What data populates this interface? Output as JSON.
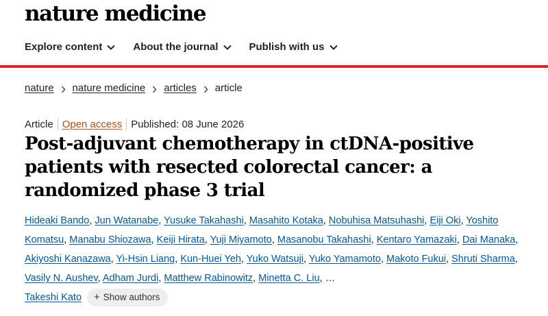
{
  "header": {
    "logo_text": "nature medicine"
  },
  "nav": {
    "items": [
      {
        "label": "Explore content"
      },
      {
        "label": "About the journal"
      },
      {
        "label": "Publish with us"
      }
    ]
  },
  "breadcrumb": {
    "items": [
      "nature",
      "nature medicine",
      "articles"
    ],
    "current": "article"
  },
  "article": {
    "type": "Article",
    "access": "Open access",
    "published": "Published: 08 June 2026",
    "title": "Post-adjuvant chemotherapy in ctDNA-positive patients with resected colorectal cancer: a randomized phase 3 trial",
    "authors": [
      "Hideaki Bando",
      "Jun Watanabe",
      "Yusuke Takahashi",
      "Masahito Kotaka",
      "Nobuhisa Matsuhashi",
      "Eiji Oki",
      "Yoshito Komatsu",
      "Manabu Shiozawa",
      "Keiji Hirata",
      "Yuji Miyamoto",
      "Masanobu Takahashi",
      "Kentaro Yamazaki",
      "Dai Manaka",
      "Akiyoshi Kanazawa",
      "Yi-Hsin Liang",
      "Kun-Huei Yeh",
      "Yuko Watsuji",
      "Yuko Yamamoto",
      "Makoto Fukui",
      "Shruti Sharma",
      "Vasily N. Aushev",
      "Adham Jurdi",
      "Matthew Rabinowitz",
      "Minetta C. Liu"
    ],
    "ellipsis": "…",
    "last_author": "Takeshi Kato",
    "show_authors_label": "Show authors"
  },
  "colors": {
    "accent_red": "#d9262d",
    "author_link": "#01579b",
    "open_access": "#b0501b"
  }
}
